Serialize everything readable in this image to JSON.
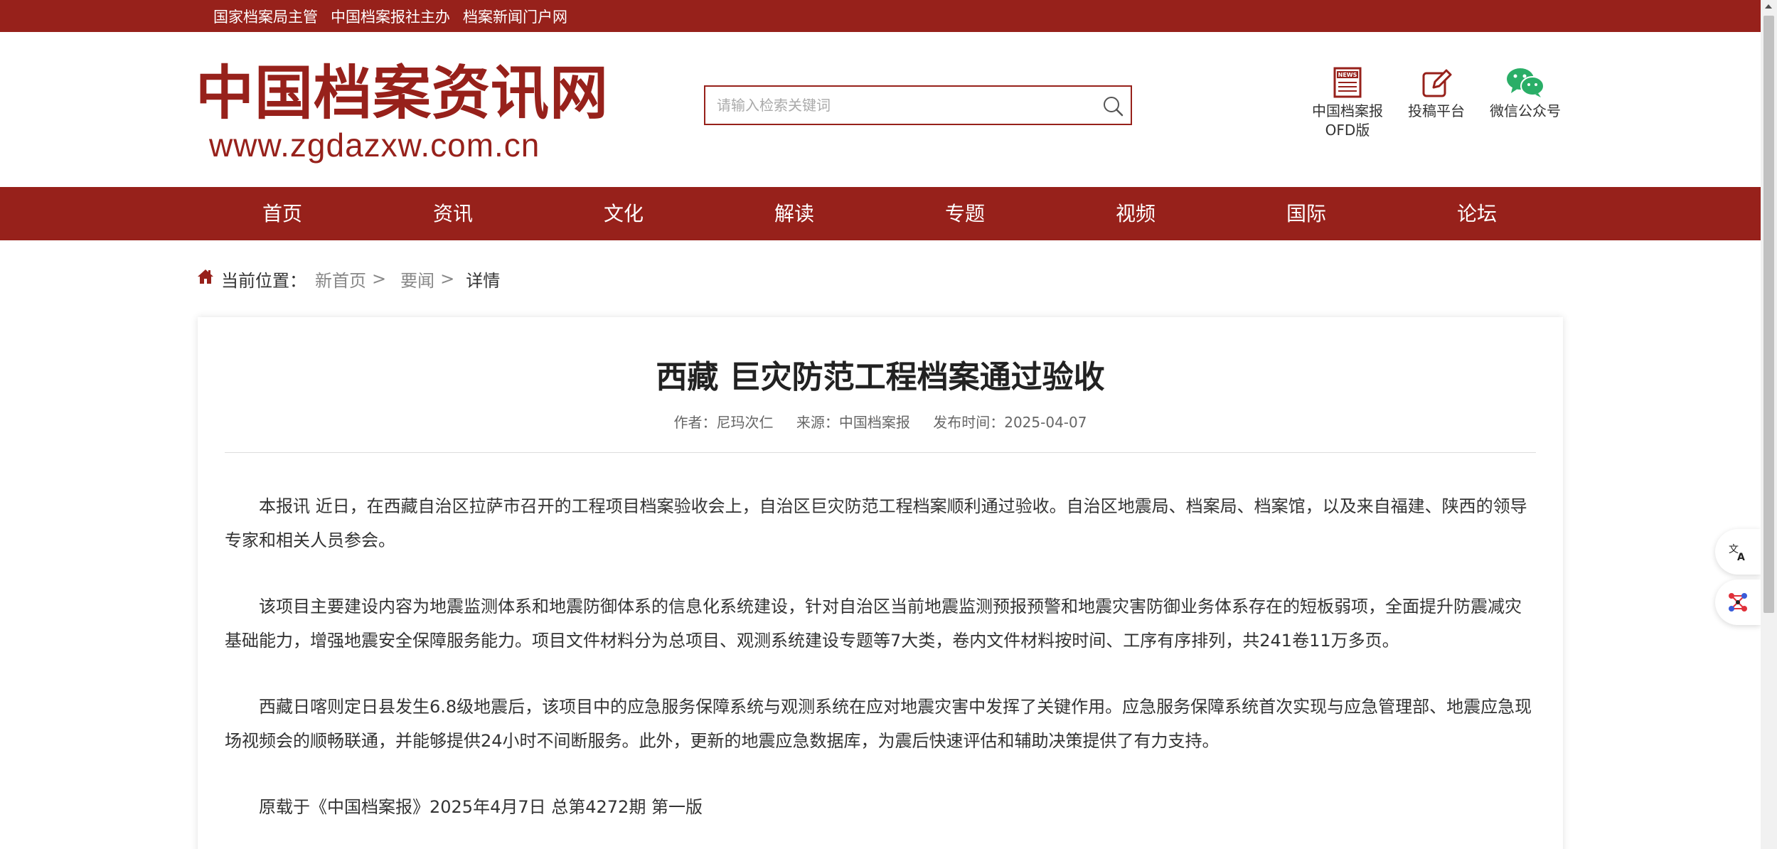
{
  "topbar": {
    "links": [
      "国家档案局主管",
      "中国档案报社主办",
      "档案新闻门户网"
    ]
  },
  "logo": {
    "name": "中国档案资讯网",
    "url": "www.zgdazxw.com.cn"
  },
  "search": {
    "placeholder": "请输入检索关键词",
    "icon": "search-icon"
  },
  "tools": [
    {
      "icon": "newspaper-icon",
      "label_line1": "中国档案报",
      "label_line2": "OFD版"
    },
    {
      "icon": "edit-icon",
      "label_line1": "投稿平台",
      "label_line2": ""
    },
    {
      "icon": "wechat-icon",
      "label_line1": "微信公众号",
      "label_line2": ""
    }
  ],
  "nav": [
    "首页",
    "资讯",
    "文化",
    "解读",
    "专题",
    "视频",
    "国际",
    "论坛"
  ],
  "breadcrumb": {
    "icon": "home-icon",
    "label": "当前位置：",
    "items": [
      "新首页",
      "要闻"
    ],
    "separator": ">",
    "current": "详情"
  },
  "article": {
    "title": "西藏 巨灾防范工程档案通过验收",
    "author": "作者：尼玛次仁",
    "source": "来源：中国档案报",
    "date": "发布时间：2025-04-07",
    "paragraphs": [
      "本报讯 近日，在西藏自治区拉萨市召开的工程项目档案验收会上，自治区巨灾防范工程档案顺利通过验收。自治区地震局、档案局、档案馆，以及来自福建、陕西的领导专家和相关人员参会。",
      "该项目主要建设内容为地震监测体系和地震防御体系的信息化系统建设，针对自治区当前地震监测预报预警和地震灾害防御业务体系存在的短板弱项，全面提升防震减灾基础能力，增强地震安全保障服务能力。项目文件材料分为总项目、观测系统建设专题等7大类，卷内文件材料按时间、工序有序排列，共241卷11万多页。",
      "西藏日喀则定日县发生6.8级地震后，该项目中的应急服务保障系统与观测系统在应对地震灾害中发挥了关键作用。应急服务保障系统首次实现与应急管理部、地震应急现场视频会的顺畅联通，并能够提供24小时不间断服务。此外，更新的地震应急数据库，为震后快速评估和辅助决策提供了有力支持。",
      "原载于《中国档案报》2025年4月7日 总第4272期 第一版"
    ]
  },
  "floating": [
    "translate-icon",
    "ai-assistant-icon"
  ],
  "colors": {
    "brand": "#97211b",
    "text": "#333333",
    "muted": "#888888"
  }
}
